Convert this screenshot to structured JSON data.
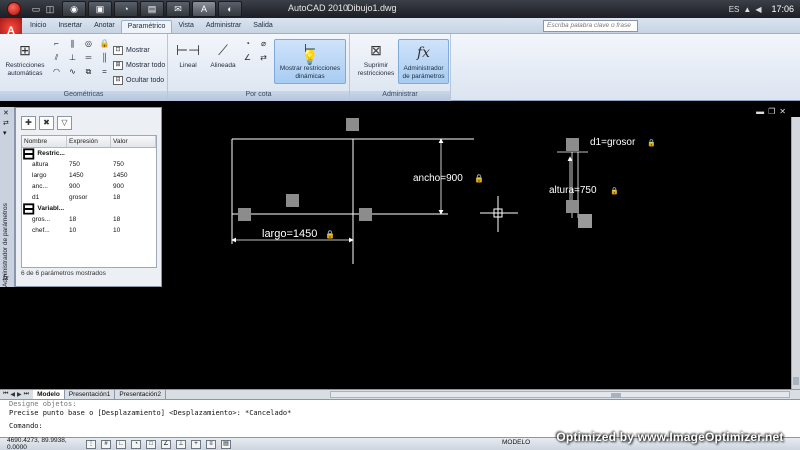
{
  "window": {
    "app_title": "AutoCAD 2010",
    "file_name": "Dibujo1.dwg"
  },
  "taskbar": {
    "apps": [
      "◉",
      "▣",
      "◔",
      "▤",
      "✉",
      "A",
      "◐"
    ],
    "tray_lang": "ES",
    "search_placeholder": "Escriba palabra clave o frase",
    "clock": "17:06"
  },
  "ribbon": {
    "tabs": [
      "Inicio",
      "Insertar",
      "Anotar",
      "Paramétrico",
      "Vista",
      "Administrar",
      "Salida"
    ],
    "active_tab": "Paramétrico",
    "panels": {
      "geometricas": {
        "title": "Geométricas",
        "auto_constraint": "Restricciones automáticas",
        "show": "Mostrar",
        "show_all": "Mostrar todo",
        "hide_all": "Ocultar todo"
      },
      "por_cota": {
        "title": "Por cota",
        "linear": "Lineal",
        "aligned": "Alineada",
        "show_dynamic": "Mostrar restricciones dinámicas"
      },
      "administrar": {
        "title": "Administrar",
        "delete_constraints": "Suprimir restricciones",
        "param_manager": "Administrador de parámetros"
      }
    }
  },
  "palette": {
    "vertical_title": "Administrador de parámetros",
    "columns": [
      "Nombre",
      "Expresión",
      "Valor"
    ],
    "groups": [
      {
        "name": "Restric...",
        "rows": [
          {
            "name": "altura",
            "expression": "750",
            "value": "750"
          },
          {
            "name": "largo",
            "expression": "1450",
            "value": "1450"
          },
          {
            "name": "anc...",
            "expression": "900",
            "value": "900"
          },
          {
            "name": "d1",
            "expression": "grosor",
            "value": "18"
          }
        ]
      },
      {
        "name": "Variabl...",
        "rows": [
          {
            "name": "gros...",
            "expression": "18",
            "value": "18"
          },
          {
            "name": "chef...",
            "expression": "10",
            "value": "10"
          }
        ]
      }
    ],
    "footer": "6 de 6 parámetros mostrados"
  },
  "drawing": {
    "dim_largo": "largo=1450",
    "dim_ancho": "ancho=900",
    "dim_d1": "d1=grosor",
    "dim_altura": "altura=750"
  },
  "layout_tabs": [
    "Modelo",
    "Presentación1",
    "Presentación2"
  ],
  "command_line": {
    "line0": "Designe objetos:",
    "line1": "Precise punto base o [Desplazamiento] <Desplazamiento>: *Cancelado*",
    "prompt": "Comando:"
  },
  "statusbar": {
    "coords": "4690.4273, 89.9938, 0.0000",
    "model": "MODELO"
  },
  "watermark": "Optimized by www.ImageOptimizer.net",
  "colors": {
    "canvas": "#000000",
    "geometry": "#ffffff",
    "grip": "#8c8c8c",
    "ribbon_highlight": "#a8ccf2"
  }
}
